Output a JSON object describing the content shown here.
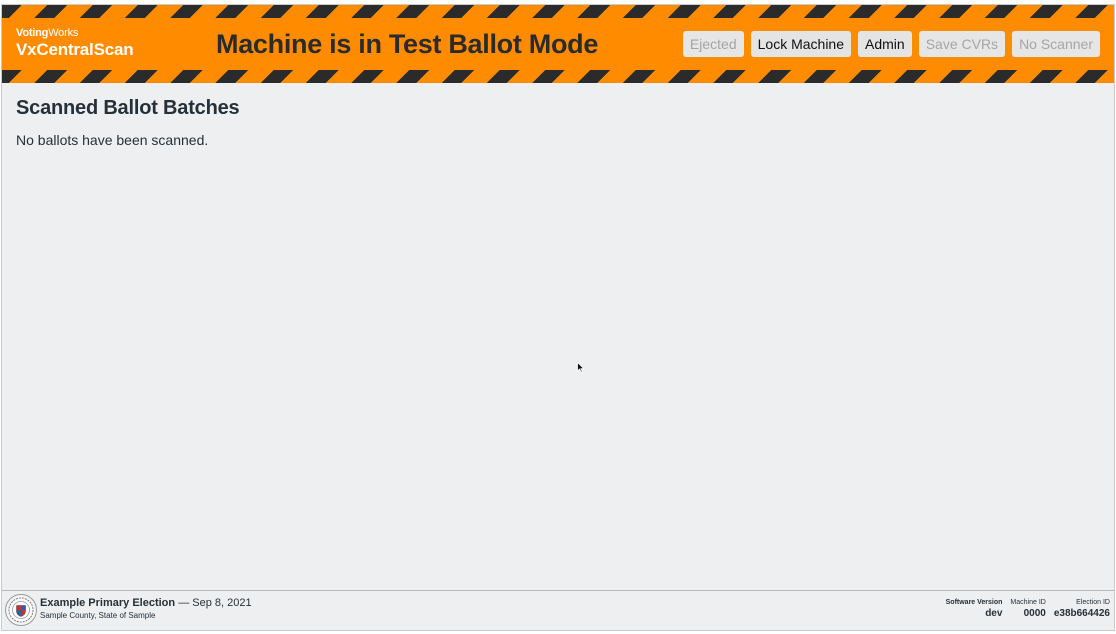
{
  "header": {
    "brand_top_bold": "Voting",
    "brand_top_rest": "Works",
    "brand_name": "VxCentralScan",
    "banner_title": "Machine is in Test Ballot Mode",
    "buttons": {
      "ejected": "Ejected",
      "lock": "Lock Machine",
      "admin": "Admin",
      "save_cvrs": "Save CVRs",
      "no_scanner": "No Scanner"
    }
  },
  "main": {
    "title": "Scanned Ballot Batches",
    "empty_message": "No ballots have been scanned."
  },
  "footer": {
    "seal_icon": "county-seal-icon",
    "election_title": "Example Primary Election",
    "separator": "—",
    "election_date": "Sep 8, 2021",
    "county": "Sample County, State of Sample",
    "software_version_label": "Software Version",
    "software_version": "dev",
    "machine_id_label": "Machine ID",
    "machine_id": "0000",
    "election_id_label": "Election ID",
    "election_id": "e38b664426"
  },
  "colors": {
    "banner": "#ff8c00",
    "stripe": "#2b2b2b",
    "background": "#edeff1"
  }
}
